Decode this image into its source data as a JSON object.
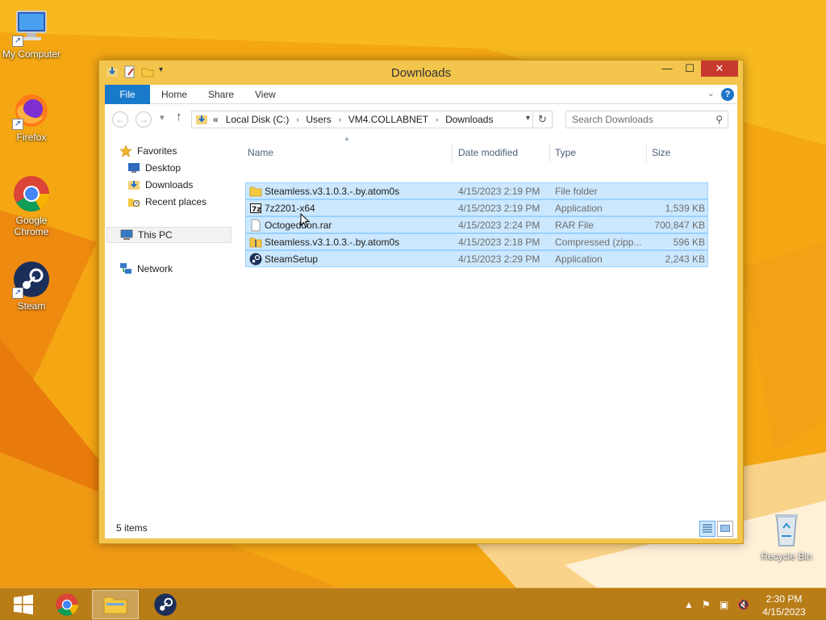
{
  "desktop": {
    "icons": [
      {
        "label": "My Computer"
      },
      {
        "label": "Firefox"
      },
      {
        "label": "Google Chrome"
      },
      {
        "label": "Steam"
      },
      {
        "label": "Recycle Bin"
      }
    ]
  },
  "window": {
    "title": "Downloads",
    "ribbon_tabs": [
      "File",
      "Home",
      "Share",
      "View"
    ],
    "help_label": "?",
    "address": {
      "overflow": "«",
      "crumbs": [
        "Local Disk (C:)",
        "Users",
        "VM4.COLLABNET",
        "Downloads"
      ],
      "separator": "›"
    },
    "search": {
      "placeholder": "Search Downloads"
    },
    "nav_pane": {
      "favorites_label": "Favorites",
      "favorites": [
        "Desktop",
        "Downloads",
        "Recent places"
      ],
      "this_pc_label": "This PC",
      "network_label": "Network"
    },
    "columns": {
      "name": "Name",
      "date": "Date modified",
      "type": "Type",
      "size": "Size"
    },
    "files": [
      {
        "name": "Steamless.v3.1.0.3.-.by.atom0s",
        "date": "4/15/2023 2:19 PM",
        "type": "File folder",
        "size": "",
        "icon": "folder-icon"
      },
      {
        "name": "7z2201-x64",
        "date": "4/15/2023 2:19 PM",
        "type": "Application",
        "size": "1,539 KB",
        "icon": "7zip-icon"
      },
      {
        "name": "Octogeddon.rar",
        "date": "4/15/2023 2:24 PM",
        "type": "RAR File",
        "size": "700,847 KB",
        "icon": "file-icon"
      },
      {
        "name": "Steamless.v3.1.0.3.-.by.atom0s",
        "date": "4/15/2023 2:18 PM",
        "type": "Compressed (zipp...",
        "size": "596 KB",
        "icon": "zip-folder-icon"
      },
      {
        "name": "SteamSetup",
        "date": "4/15/2023 2:29 PM",
        "type": "Application",
        "size": "2,243 KB",
        "icon": "steam-icon"
      }
    ],
    "status": "5 items"
  },
  "taskbar": {
    "clock_time": "2:30 PM",
    "clock_date": "4/15/2023"
  },
  "colors": {
    "accent": "#1979ca",
    "selection": "#cce8ff",
    "window_frame": "#f3c54d",
    "close_red": "#c7392c"
  }
}
